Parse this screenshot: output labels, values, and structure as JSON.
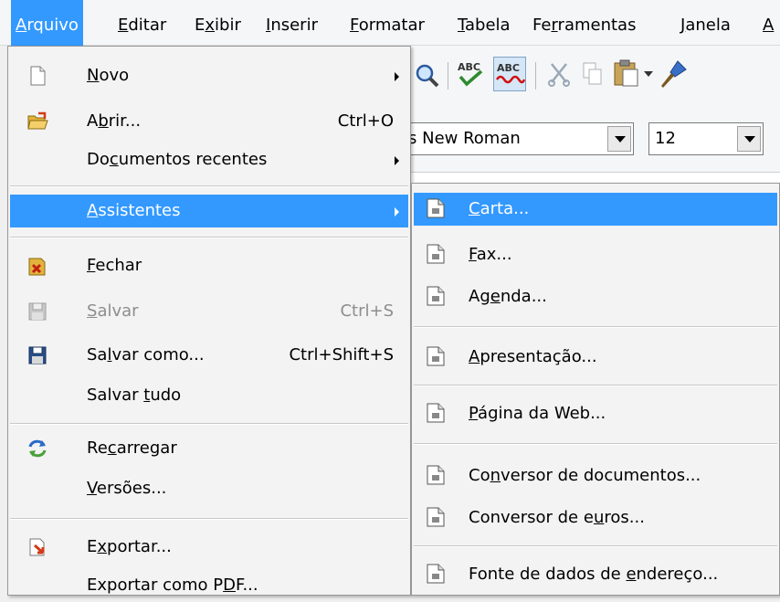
{
  "menubar": {
    "items": [
      {
        "label": "Arquivo",
        "mnemonic": "A",
        "rest": "rquivo"
      },
      {
        "label": "Editar",
        "mnemonic": "E",
        "rest": "ditar"
      },
      {
        "label": "Exibir",
        "pre": "E",
        "mnemonic": "x",
        "rest": "ibir"
      },
      {
        "label": "Inserir",
        "mnemonic": "I",
        "rest": "nserir"
      },
      {
        "label": "Formatar",
        "mnemonic": "F",
        "rest": "ormatar"
      },
      {
        "label": "Tabela",
        "mnemonic": "T",
        "rest": "abela"
      },
      {
        "label": "Ferramentas",
        "pre": "Fe",
        "mnemonic": "r",
        "rest": "ramentas"
      },
      {
        "label": "Janela",
        "mnemonic": "J",
        "rest": "anela"
      },
      {
        "label": "A",
        "mnemonic": "A",
        "rest": ""
      }
    ]
  },
  "toolbar": {
    "font_name": "s New Roman",
    "font_size": "12"
  },
  "file_menu": {
    "items": [
      {
        "pre": "",
        "m": "N",
        "post": "ovo",
        "shortcut": "",
        "submenu": true,
        "icon": "new-document-icon"
      },
      {
        "pre": "A",
        "m": "b",
        "post": "rir...",
        "shortcut": "Ctrl+O",
        "submenu": false,
        "icon": "open-folder-icon"
      },
      {
        "pre": "Do",
        "m": "c",
        "post": "umentos recentes",
        "shortcut": "",
        "submenu": true,
        "icon": ""
      },
      {
        "pre": "",
        "m": "A",
        "post": "ssistentes",
        "shortcut": "",
        "submenu": true,
        "icon": "",
        "highlight": true
      },
      {
        "pre": "",
        "m": "F",
        "post": "echar",
        "shortcut": "",
        "submenu": false,
        "icon": "close-document-icon"
      },
      {
        "pre": "",
        "m": "S",
        "post": "alvar",
        "shortcut": "Ctrl+S",
        "submenu": false,
        "icon": "save-icon",
        "disabled": true
      },
      {
        "pre": "Sa",
        "m": "l",
        "post": "var como...",
        "shortcut": "Ctrl+Shift+S",
        "submenu": false,
        "icon": "save-as-icon"
      },
      {
        "pre": "Salvar ",
        "m": "t",
        "post": "udo",
        "shortcut": "",
        "submenu": false,
        "icon": ""
      },
      {
        "pre": "Re",
        "m": "c",
        "post": "arregar",
        "shortcut": "",
        "submenu": false,
        "icon": "reload-icon"
      },
      {
        "pre": "",
        "m": "V",
        "post": "ersões...",
        "shortcut": "",
        "submenu": false,
        "icon": ""
      },
      {
        "pre": "E",
        "m": "x",
        "post": "portar...",
        "shortcut": "",
        "submenu": false,
        "icon": "export-icon"
      },
      {
        "pre": "Exportar como P",
        "m": "D",
        "post": "F...",
        "shortcut": "",
        "submenu": false,
        "icon": ""
      }
    ]
  },
  "wizards_menu": {
    "items": [
      {
        "pre": "",
        "m": "C",
        "post": "arta...",
        "highlight": true
      },
      {
        "pre": "",
        "m": "F",
        "post": "ax..."
      },
      {
        "pre": "Ag",
        "m": "e",
        "post": "nda..."
      },
      {
        "pre": "",
        "m": "A",
        "post": "presentação..."
      },
      {
        "pre": "",
        "m": "P",
        "post": "ágina da Web..."
      },
      {
        "pre": "Co",
        "m": "n",
        "post": "versor de documentos..."
      },
      {
        "pre": "Conversor de e",
        "m": "u",
        "post": "ros..."
      },
      {
        "pre": "Fonte de dados de ",
        "m": "e",
        "post": "ndereço..."
      }
    ]
  }
}
